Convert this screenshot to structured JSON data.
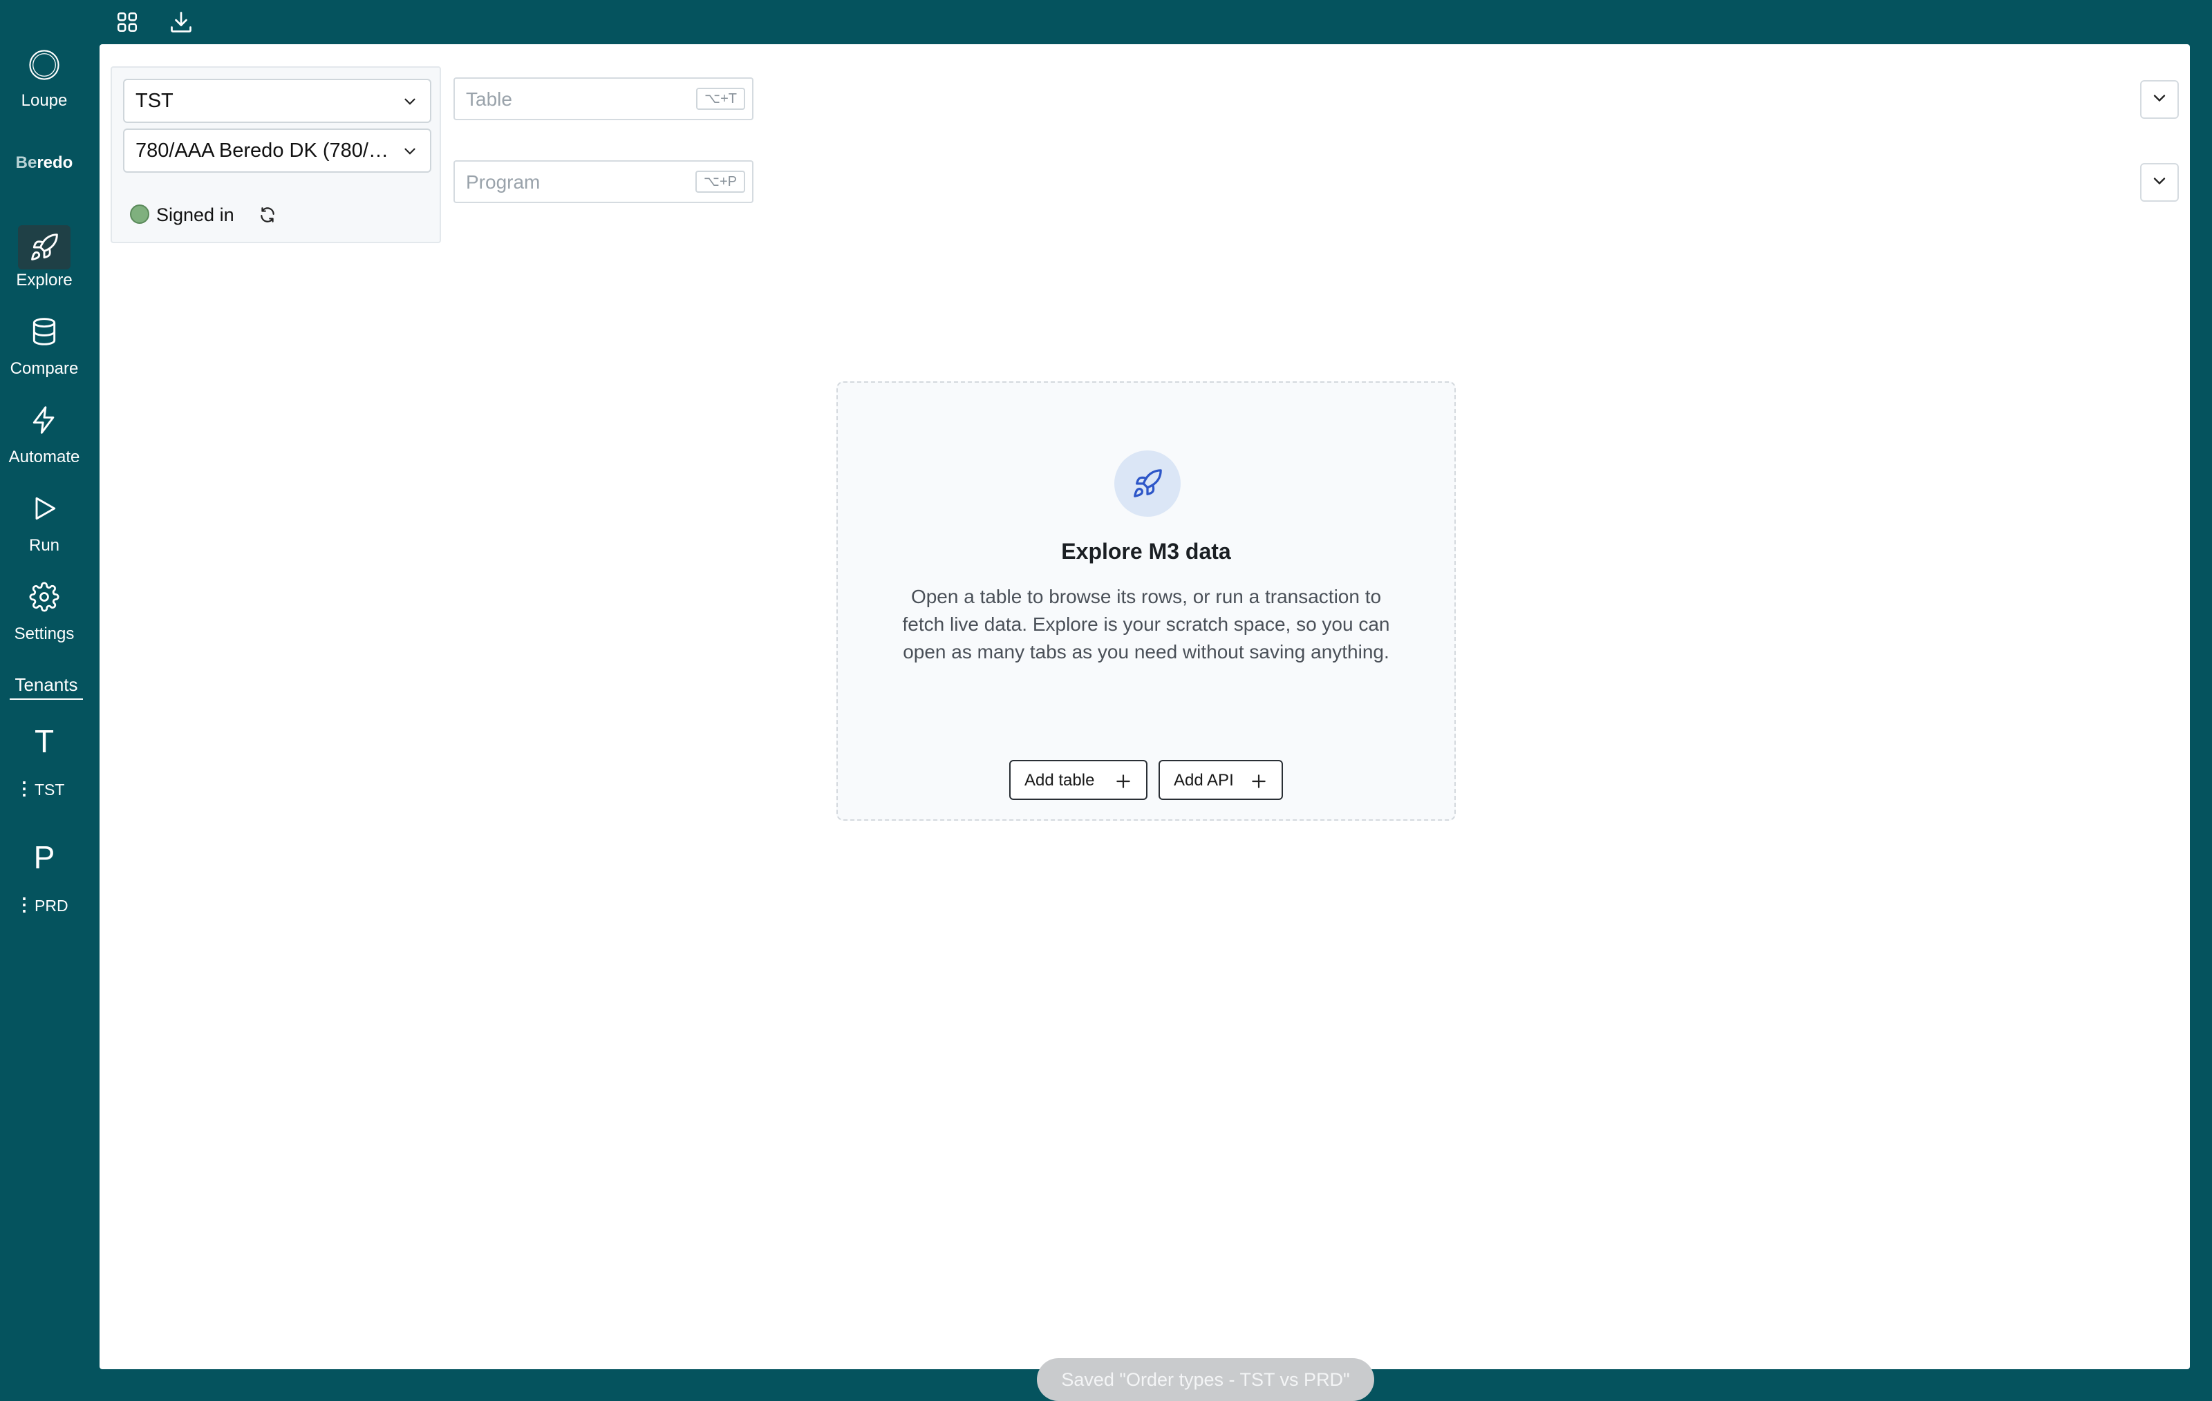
{
  "sidebar": {
    "app_name": "Loupe",
    "brand_prefix": "Be",
    "brand_suffix": "redo",
    "nav": [
      {
        "label": "Explore",
        "icon": "rocket-icon",
        "active": true
      },
      {
        "label": "Compare",
        "icon": "database-icon",
        "active": false
      },
      {
        "label": "Automate",
        "icon": "lightning-icon",
        "active": false
      },
      {
        "label": "Run",
        "icon": "play-icon",
        "active": false
      },
      {
        "label": "Settings",
        "icon": "gear-icon",
        "active": false
      }
    ],
    "tenants_heading": "Tenants",
    "tenants": [
      {
        "letter": "T",
        "name": "TST"
      },
      {
        "letter": "P",
        "name": "PRD"
      }
    ]
  },
  "topbar": {
    "icons": [
      "grid-icon",
      "download-icon"
    ]
  },
  "connection": {
    "environment": "TST",
    "company": "780/AAA Beredo DK (780/AAA)",
    "status": "Signed in",
    "status_color": "#7fb07e"
  },
  "search": {
    "table_placeholder": "Table",
    "table_shortcut": "⌥+T",
    "program_placeholder": "Program",
    "program_shortcut": "⌥+P"
  },
  "empty_state": {
    "title": "Explore M3 data",
    "description": "Open a table to browse its rows, or run a transaction to fetch live data. Explore is your scratch space, so you can open as many tabs as you need without saving anything.",
    "add_table_label": "Add table",
    "add_api_label": "Add API"
  },
  "toast": {
    "message": "Saved \"Order types - TST vs PRD\""
  },
  "colors": {
    "sidebar_bg": "#05535e",
    "accent_blue": "#2d56c8"
  }
}
